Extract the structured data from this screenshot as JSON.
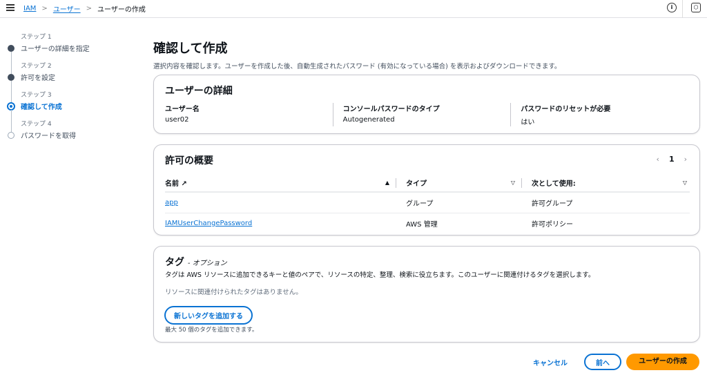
{
  "breadcrumb": [
    "IAM",
    "ユーザー",
    "ユーザーの作成"
  ],
  "steps": [
    {
      "num": "ステップ 1",
      "label": "ユーザーの詳細を指定"
    },
    {
      "num": "ステップ 2",
      "label": "許可を設定"
    },
    {
      "num": "ステップ 3",
      "label": "確認して作成"
    },
    {
      "num": "ステップ 4",
      "label": "パスワードを取得"
    }
  ],
  "page": {
    "title": "確認して作成",
    "subtitle": "選択内容を確認します。ユーザーを作成した後、自動生成されたパスワード (有効になっている場合) を表示およびダウンロードできます。"
  },
  "details": {
    "title": "ユーザーの詳細",
    "fields": [
      {
        "key": "ユーザー名",
        "value": "user02"
      },
      {
        "key": "コンソールパスワードのタイプ",
        "value": "Autogenerated"
      },
      {
        "key": "パスワードのリセットが必要",
        "value": "はい"
      }
    ]
  },
  "permissions": {
    "title": "許可の概要",
    "page": "1",
    "columns": [
      "名前",
      "タイプ",
      "次として使用:"
    ],
    "rows": [
      {
        "name": "app",
        "type": "グループ",
        "used_as": "許可グループ"
      },
      {
        "name": "IAMUserChangePassword",
        "type": "AWS 管理",
        "used_as": "許可ポリシー"
      }
    ]
  },
  "tags": {
    "title": "タグ",
    "optional": "- オプション",
    "description": "タグは AWS リソースに追加できるキーと値のペアで、リソースの特定、整理、検索に役立ちます。このユーザーに関連付けるタグを選択します。",
    "empty": "リソースに関連付けられたタグはありません。",
    "add_button": "新しいタグを追加する",
    "limit": "最大 50 個のタグを追加できます。"
  },
  "footer": {
    "cancel": "キャンセル",
    "previous": "前へ",
    "create": "ユーザーの作成"
  }
}
